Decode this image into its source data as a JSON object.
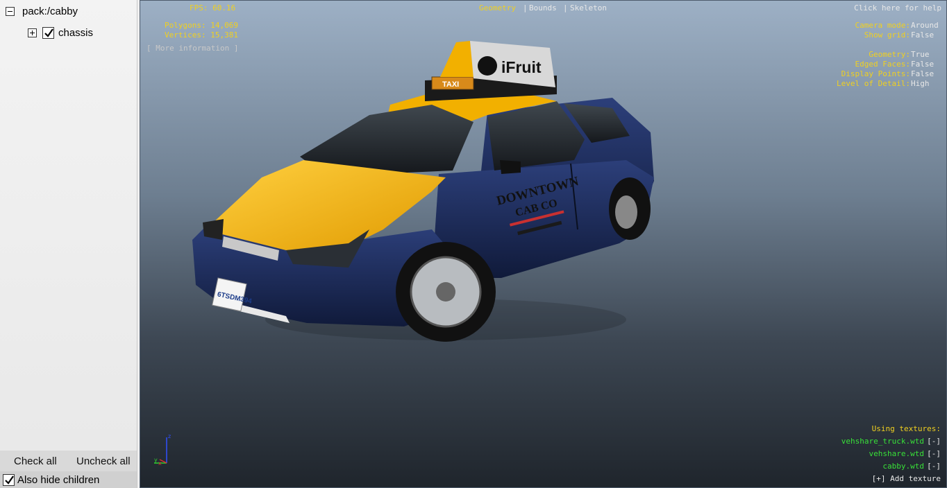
{
  "tree": {
    "root_label": "pack:/cabby",
    "child_label": "chassis"
  },
  "footer": {
    "check_all": "Check all",
    "uncheck_all": "Uncheck all",
    "also_hide_children": "Also hide children"
  },
  "stats": {
    "fps": "FPS: 60.16",
    "polygons": "Polygons: 14,069",
    "vertices": "Vertices: 15,381",
    "more_info": "[ More information ]"
  },
  "view_tabs": {
    "geometry": "Geometry",
    "bounds": "Bounds",
    "skeleton": "Skeleton",
    "sep": "|"
  },
  "help": "Click here for help",
  "settings": {
    "camera_mode_label": "Camera mode:",
    "camera_mode_value": "Around",
    "show_grid_label": "Show grid:",
    "show_grid_value": "False",
    "geometry_label": "Geometry:",
    "geometry_value": "True",
    "edged_faces_label": "Edged Faces:",
    "edged_faces_value": "False",
    "display_points_label": "Display Points:",
    "display_points_value": "False",
    "lod_label": "Level of Detail:",
    "lod_value": "High"
  },
  "textures": {
    "header": "Using textures:",
    "items": [
      {
        "name": "vehshare_truck.wtd",
        "action": "[-]"
      },
      {
        "name": "vehshare.wtd",
        "action": "[-]"
      },
      {
        "name": "cabby.wtd",
        "action": "[-]"
      }
    ],
    "add_texture": "[+] Add texture"
  },
  "model": {
    "roof_sign": "iFruit",
    "taxi_light": "TAXI",
    "door_line1": "DOWNTOWN",
    "door_line2": "CAB CO",
    "plate": "6TSDM394"
  },
  "axis": {
    "z": "z",
    "y": "y",
    "x": "x"
  },
  "colors": {
    "taxi_yellow": "#f2b000",
    "taxi_blue": "#1e2d5e",
    "hud_yellow": "#f0d020",
    "hud_green": "#38e038"
  }
}
